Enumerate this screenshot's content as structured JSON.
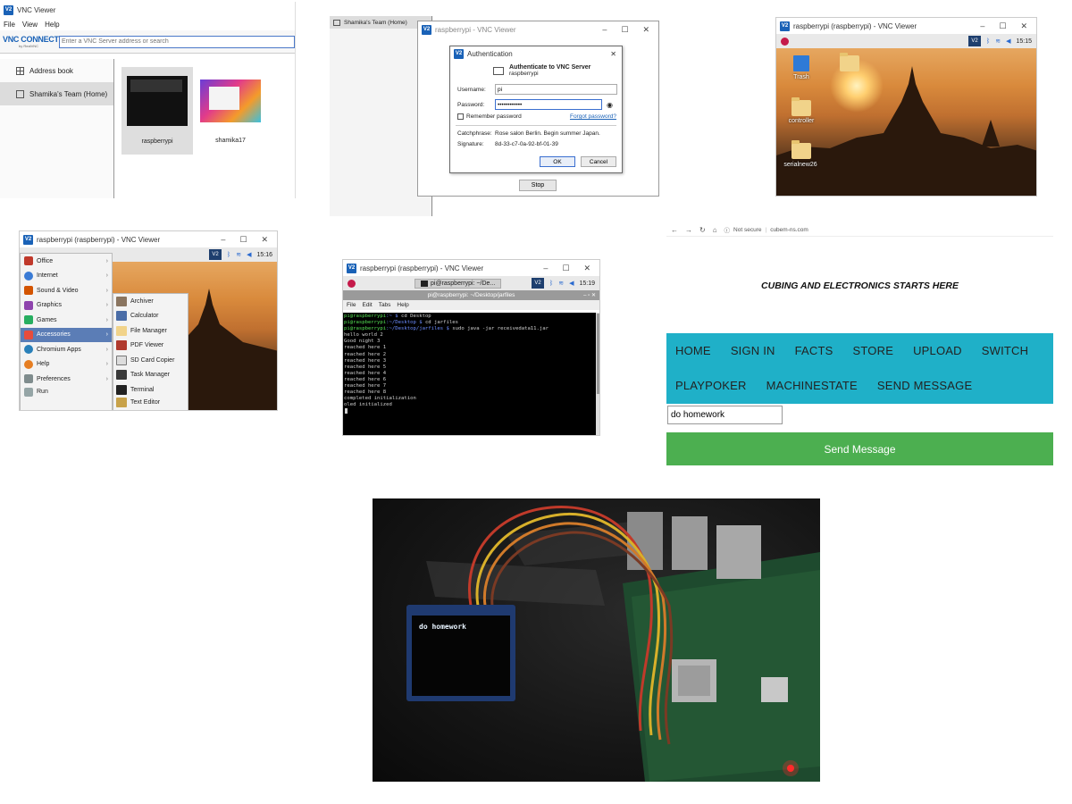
{
  "panel1": {
    "title": "VNC Viewer",
    "menu": [
      "File",
      "View",
      "Help"
    ],
    "brand_main": "VNC CONNECT",
    "brand_sub": "by RealVNC",
    "search_placeholder": "Enter a VNC Server address or search",
    "sidebar": [
      "Address book",
      "Shamika's Team (Home)"
    ],
    "computers": [
      "raspberrypi",
      "shamika17"
    ]
  },
  "panel2": {
    "bg_tab": "Shamika's Team (Home)",
    "window_title": "raspberrypi - VNC Viewer",
    "dialog_title": "Authentication",
    "heading": "Authenticate to VNC Server",
    "server": "raspberrypi",
    "username_label": "Username:",
    "username_value": "pi",
    "password_label": "Password:",
    "password_value": "••••••••••••",
    "remember_label": "Remember password",
    "forgot_link": "Forgot password?",
    "catchphrase_label": "Catchphrase:",
    "catchphrase_value": "Rose salon Berlin. Begin summer Japan.",
    "signature_label": "Signature:",
    "signature_value": "8d-33-c7-0a-92-bf-01-39",
    "ok_label": "OK",
    "cancel_label": "Cancel",
    "stop_label": "Stop"
  },
  "panel3": {
    "title": "raspberrypi (raspberrypi) - VNC Viewer",
    "vnc_badge": "V2",
    "clock": "15:15",
    "icons": [
      "Trash",
      "controller",
      "serialnew26"
    ]
  },
  "panel4": {
    "title": "raspberrypi (raspberrypi) - VNC Viewer",
    "vnc_badge": "V2",
    "clock": "15:16",
    "menu": [
      "Office",
      "Internet",
      "Sound & Video",
      "Graphics",
      "Games",
      "Accessories",
      "Chromium Apps",
      "Help",
      "Preferences",
      "Run"
    ],
    "submenu": [
      "Archiver",
      "Calculator",
      "File Manager",
      "PDF Viewer",
      "SD Card Copier",
      "Task Manager",
      "Terminal",
      "Text Editor"
    ]
  },
  "panel5": {
    "title": "raspberrypi (raspberrypi) - VNC Viewer",
    "vnc_badge": "V2",
    "clock": "15:19",
    "task_label": "pi@raspberrypi: ~/De...",
    "terminal_title": "pi@raspberrypi: ~/Desktop/jarfiles",
    "terminal_menu": [
      "File",
      "Edit",
      "Tabs",
      "Help"
    ],
    "prompts": [
      {
        "user": "pi@raspberrypi",
        "path": ":~ $ ",
        "cmd": "cd Desktop"
      },
      {
        "user": "pi@raspberrypi",
        "path": ":~/Desktop $ ",
        "cmd": "cd jarfiles"
      },
      {
        "user": "pi@raspberrypi",
        "path": ":~/Desktop/jarfiles $ ",
        "cmd": "sudo java -jar receivedata11.jar"
      }
    ],
    "output": [
      "hello world 2",
      "Good night 3",
      "reached here 1",
      "reached here 2",
      "reached here 3",
      "reached here 5",
      "reached here 4",
      "reached here 6",
      "reached here 7",
      "reached here 8",
      "completed initialization",
      "oled initialized"
    ]
  },
  "panel6": {
    "security": "Not secure",
    "url": "cubem-ns.com",
    "heading": "CUBING AND ELECTRONICS STARTS HERE",
    "nav": [
      "HOME",
      "SIGN IN",
      "FACTS",
      "STORE",
      "UPLOAD",
      "SWITCH",
      "PLAYPOKER",
      "MACHINESTATE",
      "SEND MESSAGE"
    ],
    "message_value": "do homework",
    "send_label": "Send Message"
  },
  "photo": {
    "oled_text": "do homework"
  },
  "colors": {
    "nav_teal": "#1fb0c8",
    "send_green": "#4caf50",
    "vnc_blue": "#1a62b7"
  }
}
